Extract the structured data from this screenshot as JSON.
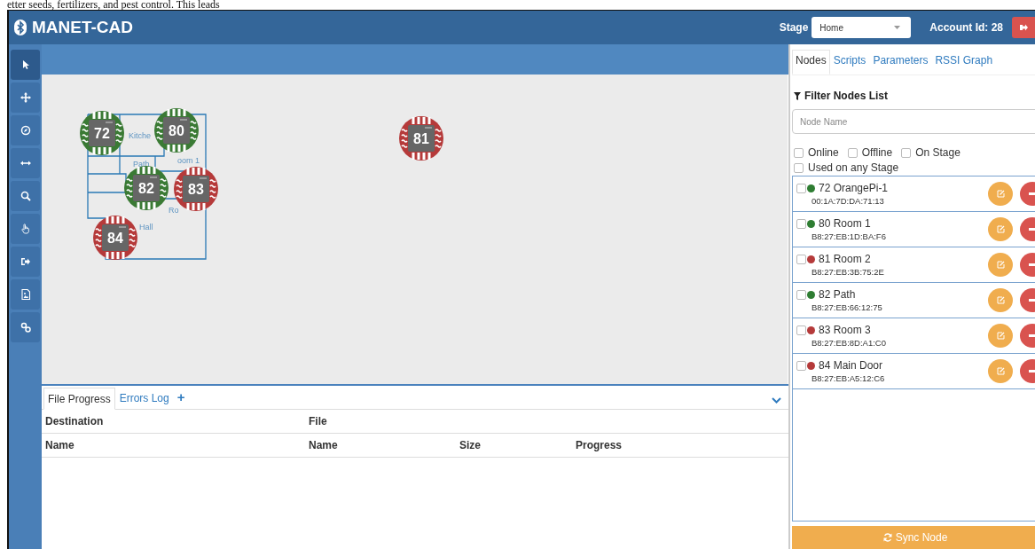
{
  "document_text": "etter seeds, fertilizers, and pest control. This leads",
  "header": {
    "title": "MANET-CAD",
    "stage_label": "Stage",
    "stage_value": "Home",
    "account": "Account Id: 28"
  },
  "toolbar": [
    {
      "selected": true
    },
    {
      "selected": false
    },
    {
      "selected": false
    },
    {
      "selected": false
    },
    {
      "selected": false
    },
    {
      "selected": false
    },
    {
      "selected": false
    },
    {
      "selected": false
    },
    {
      "selected": false
    }
  ],
  "floor_plan": {
    "rooms": [
      "Kitche",
      "oom 1",
      "Path",
      "Ro",
      "Hall"
    ]
  },
  "canvas_nodes": [
    {
      "label": "72",
      "color": "#3a7a34"
    },
    {
      "label": "80",
      "color": "#3a7a34"
    },
    {
      "label": "81",
      "color": "#b53a3a"
    },
    {
      "label": "82",
      "color": "#3a7a34"
    },
    {
      "label": "83",
      "color": "#b53a3a"
    },
    {
      "label": "84",
      "color": "#b53a3a"
    }
  ],
  "bottom_panel": {
    "tabs": [
      {
        "label": "File Progress",
        "selected": true
      },
      {
        "label": "Errors Log",
        "selected": false
      }
    ],
    "add": "+",
    "group_headers": [
      "Destination",
      "File"
    ],
    "columns": [
      "Name",
      "Name",
      "Size",
      "Progress"
    ]
  },
  "side_panel": {
    "tabs": [
      {
        "label": "Nodes",
        "selected": true
      },
      {
        "label": "Scripts",
        "selected": false
      },
      {
        "label": "Parameters",
        "selected": false
      },
      {
        "label": "RSSI Graph",
        "selected": false
      }
    ],
    "filter_title": "Filter Nodes List",
    "search": {
      "placeholder": "Node Name"
    },
    "filters": [
      {
        "label": "Online",
        "checked": false
      },
      {
        "label": "Offline",
        "checked": false
      },
      {
        "label": "On Stage",
        "checked": false
      },
      {
        "label": "Used on any Stage",
        "checked": false
      }
    ],
    "nodes": [
      {
        "name": "72 OrangePi-1",
        "mac": "00:1A:7D:DA:71:13",
        "color": "#2e7d32",
        "checked": false
      },
      {
        "name": "80 Room 1",
        "mac": "B8:27:EB:1D:BA:F6",
        "color": "#2e7d32",
        "checked": false
      },
      {
        "name": "81 Room 2",
        "mac": "B8:27:EB:3B:75:2E",
        "color": "#b53a3a",
        "checked": false
      },
      {
        "name": "82 Path",
        "mac": "B8:27:EB:66:12:75",
        "color": "#2e7d32",
        "checked": false
      },
      {
        "name": "83 Room 3",
        "mac": "B8:27:EB:8D:A1:C0",
        "color": "#b53a3a",
        "checked": false
      },
      {
        "name": "84 Main Door",
        "mac": "B8:27:EB:A5:12:C6",
        "color": "#b53a3a",
        "checked": false
      }
    ],
    "sync_button": "Sync Node"
  }
}
